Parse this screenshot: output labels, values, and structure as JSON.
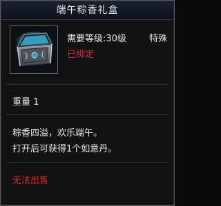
{
  "item": {
    "title": "端午粽香礼盒",
    "level_requirement": "需要等级:30级",
    "category": "特殊",
    "bind_status": "已绑定",
    "weight": "重量 1",
    "description_line1": "粽香四溢，欢乐端午。",
    "description_line2": "打开后可获得1个如意丹。",
    "sell_status": "无法出售",
    "icon": "treasure-chest-icon"
  },
  "colors": {
    "text": "#e8e8e8",
    "warning": "#d8262a",
    "chest_glow": "#4fd7ff"
  }
}
